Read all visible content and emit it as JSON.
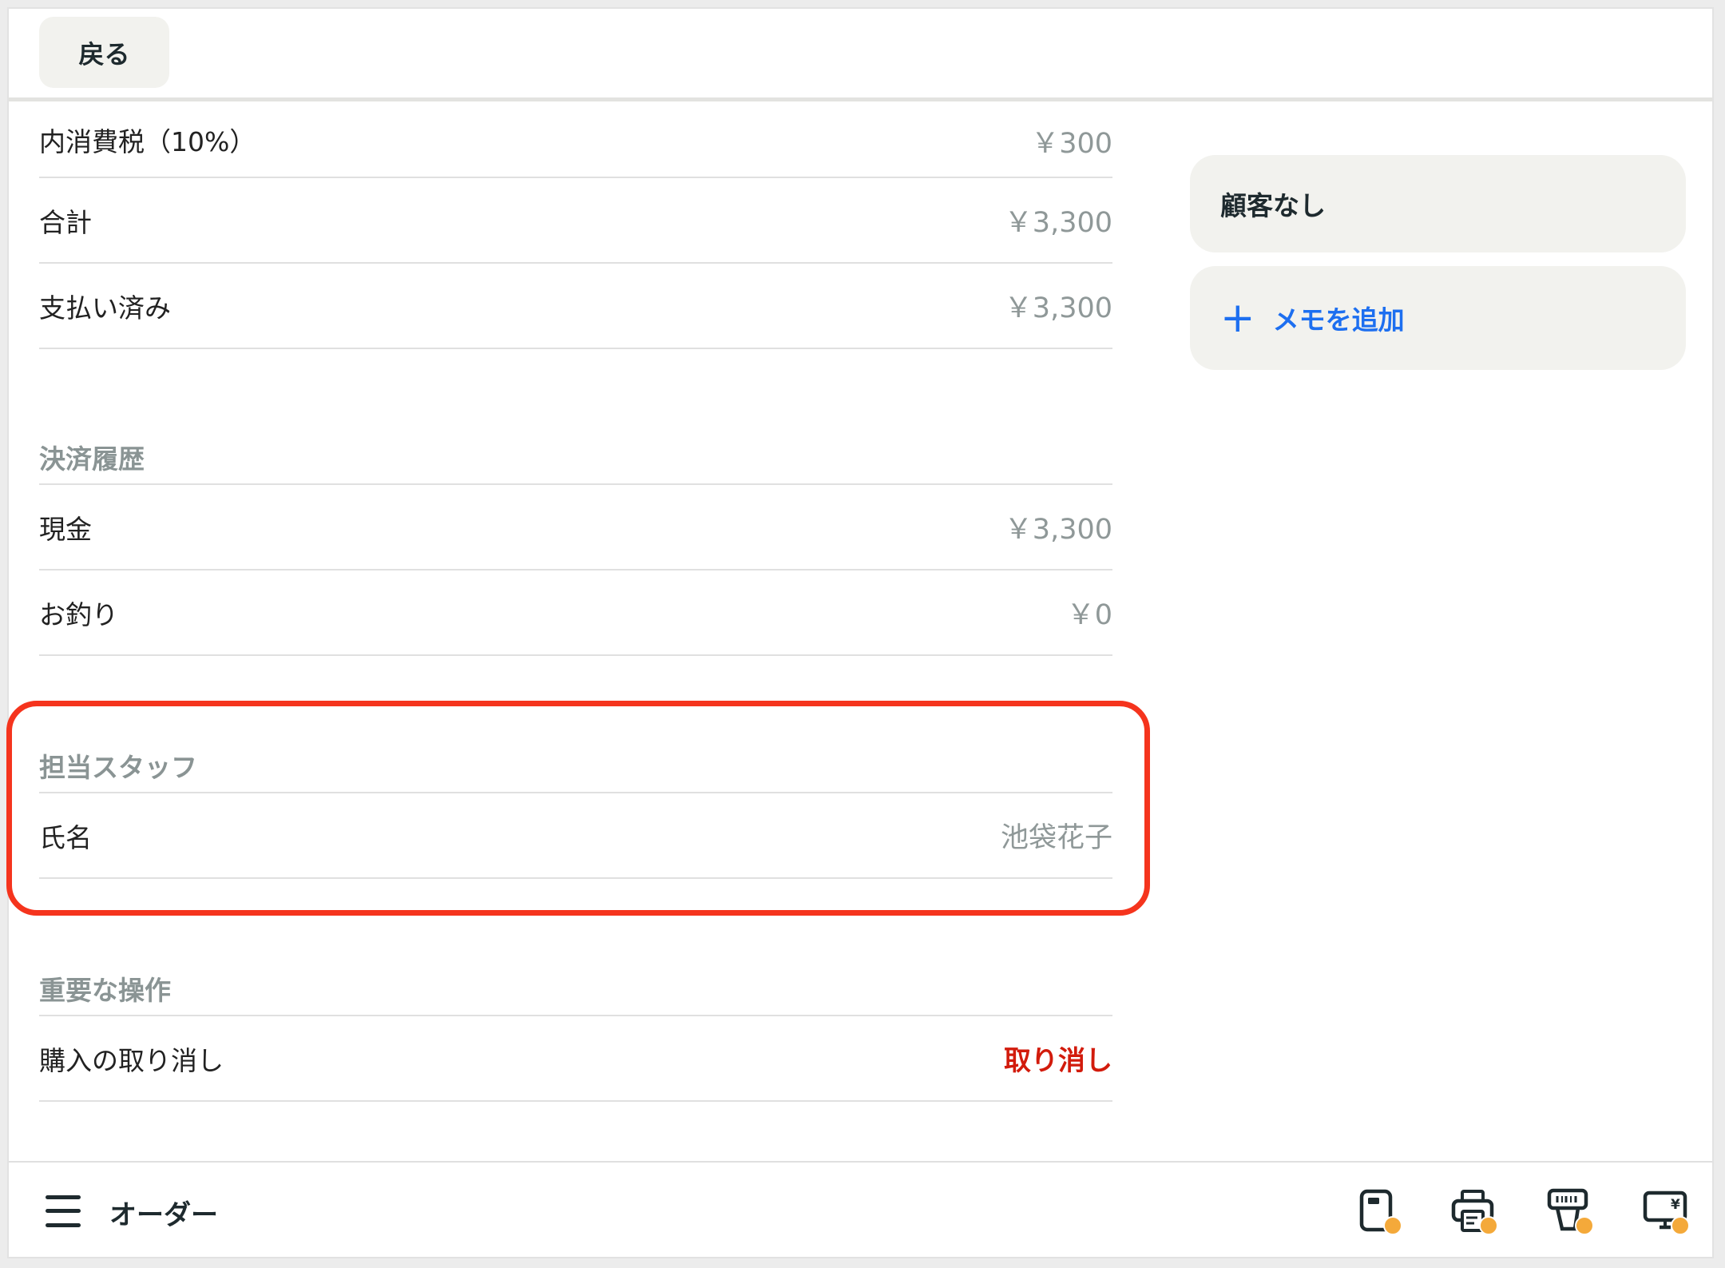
{
  "header": {
    "back_label": "戻る"
  },
  "summary": [
    {
      "label": "内消費税（10%）",
      "value": "￥300"
    },
    {
      "label": "合計",
      "value": "￥3,300"
    },
    {
      "label": "支払い済み",
      "value": "￥3,300"
    }
  ],
  "payment_history": {
    "title": "決済履歴",
    "rows": [
      {
        "label": "現金",
        "value": "￥3,300"
      },
      {
        "label": "お釣り",
        "value": "￥0"
      }
    ]
  },
  "staff": {
    "title": "担当スタッフ",
    "name_label": "氏名",
    "name_value": "池袋花子"
  },
  "important_actions": {
    "title": "重要な操作",
    "cancel_label": "購入の取り消し",
    "cancel_button": "取り消し"
  },
  "sidebar": {
    "customer": "顧客なし",
    "add_memo": "メモを追加"
  },
  "footer": {
    "title": "オーダー",
    "icons": [
      "card-reader-icon",
      "printer-icon",
      "barcode-scanner-icon",
      "customer-display-icon"
    ],
    "status_color": "#f4a93a"
  },
  "colors": {
    "accent": "#1d6ff0",
    "danger": "#d21b0c",
    "highlight": "#f5341d"
  }
}
